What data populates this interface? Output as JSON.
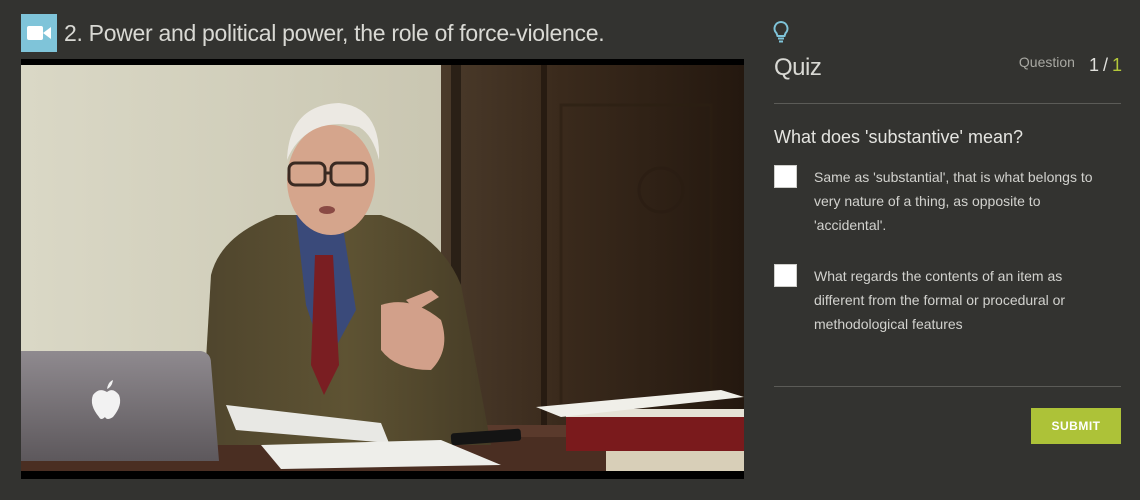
{
  "lesson": {
    "title": "2. Power and political power, the role of force-violence."
  },
  "video": {
    "description": "lecture video"
  },
  "quiz": {
    "heading": "Quiz",
    "question_label": "Question",
    "current": "1",
    "separator": "/",
    "total": "1",
    "question": "What does 'substantive' mean?",
    "options": [
      {
        "text": "Same as 'substantial', that is what belongs to very nature of a thing, as opposite to 'accidental'.",
        "checked": false
      },
      {
        "text": "What regards the contents of an item as different from the formal or procedural or methodological features",
        "checked": false
      }
    ],
    "submit_label": "SUBMIT"
  },
  "colors": {
    "background": "#333330",
    "video_icon_bg": "#7fc4d9",
    "accent": "#adc238",
    "counter_total": "#b4c83a"
  },
  "icons": [
    "video-camera-icon",
    "lightbulb-icon",
    "apple-logo-icon"
  ]
}
